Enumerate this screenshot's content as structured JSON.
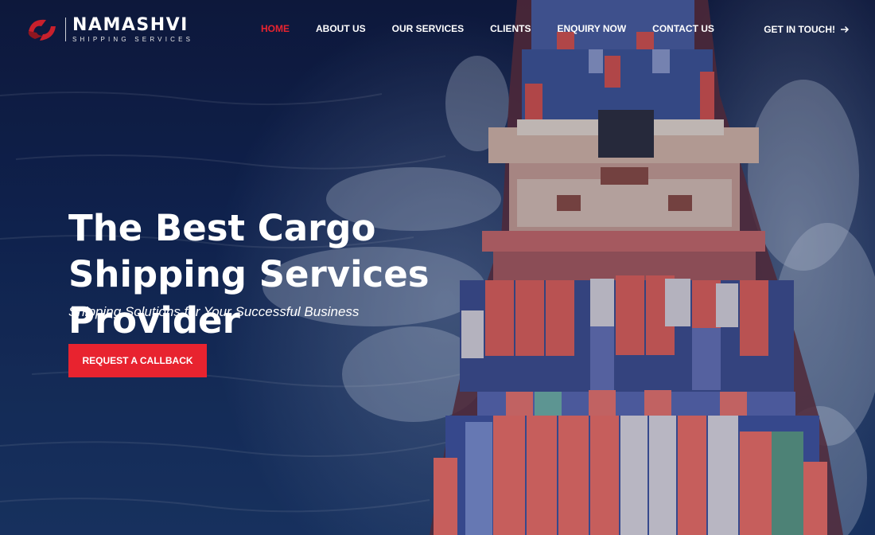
{
  "brand": {
    "name": "NAMASHVI",
    "tagline": "SHIPPING SERVICES",
    "accent": "#e8232f"
  },
  "nav": {
    "items": [
      {
        "label": "HOME",
        "active": true
      },
      {
        "label": "ABOUT US",
        "active": false
      },
      {
        "label": "OUR SERVICES",
        "active": false
      },
      {
        "label": "CLIENTS",
        "active": false
      },
      {
        "label": "ENQUIRY NOW",
        "active": false
      },
      {
        "label": "CONTACT US",
        "active": false
      }
    ],
    "cta_label": "GET IN TOUCH!",
    "cta_icon": "arrow-right-icon"
  },
  "hero": {
    "title": "The Best Cargo Shipping Services Provider",
    "subtitle": "Shipping Solutions for Your Successful Business",
    "button_label": "REQUEST A CALLBACK"
  }
}
